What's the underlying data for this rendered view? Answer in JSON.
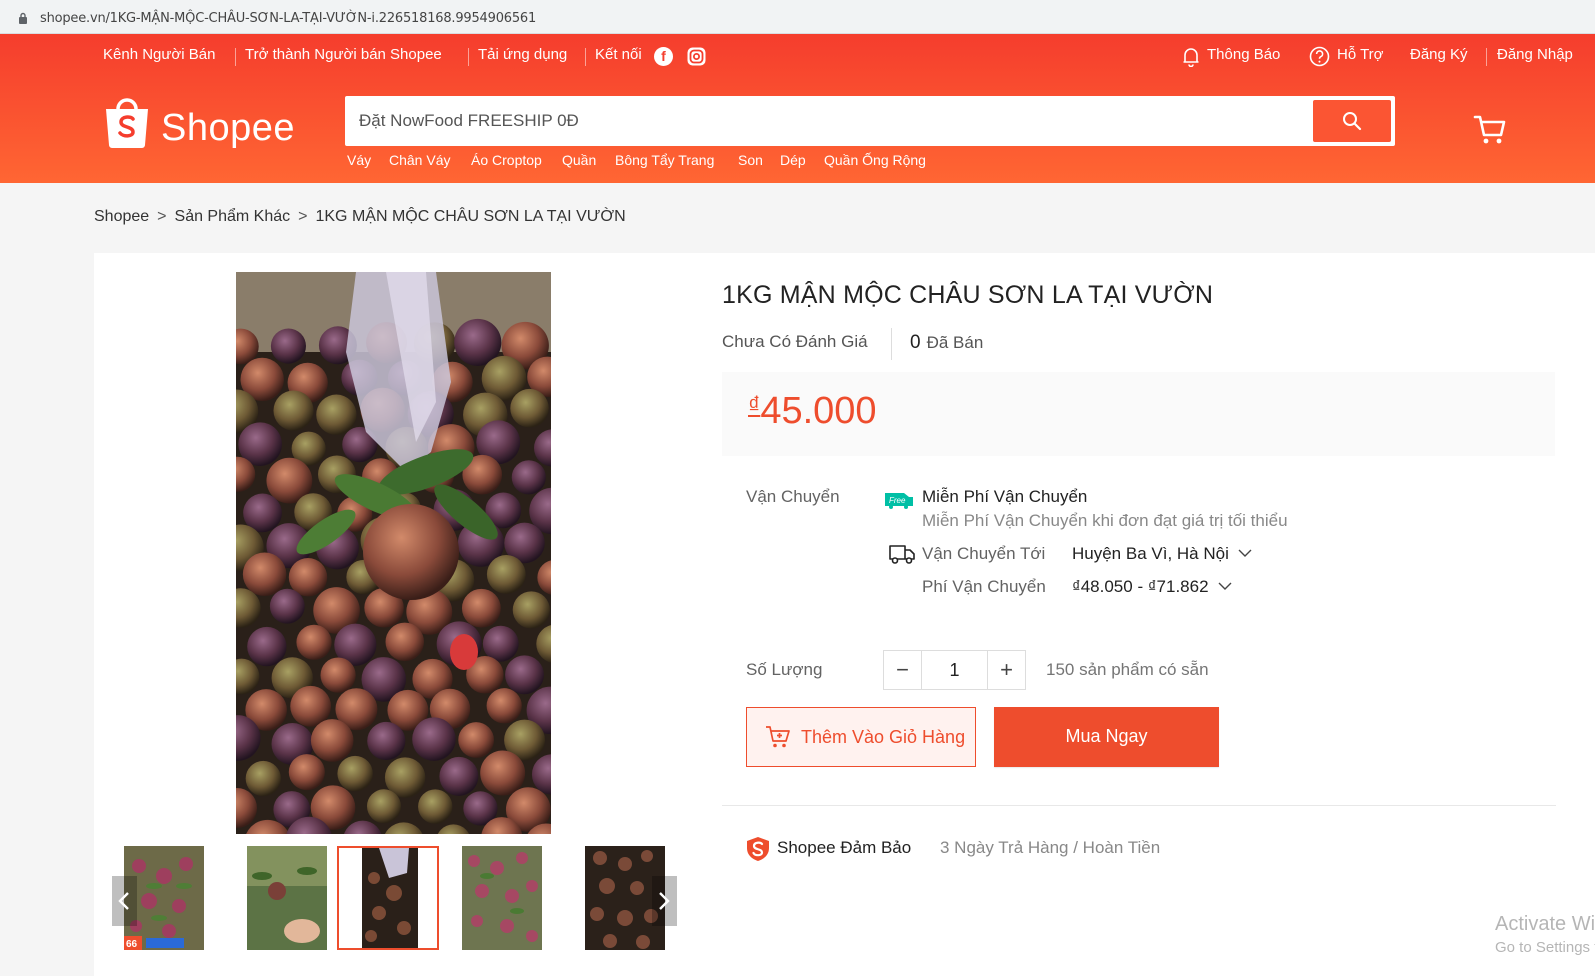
{
  "browser": {
    "url": "shopee.vn/1KG-MẬN-MỘC-CHÂU-SƠN-LA-TẠI-VƯỜN-i.226518168.9954906561"
  },
  "header": {
    "topnav_left": [
      "Kênh Người Bán",
      "Trở thành Người bán Shopee",
      "Tải ứng dụng",
      "Kết nối"
    ],
    "topnav_right": {
      "notifications": "Thông Báo",
      "help": "Hỗ Trợ",
      "register": "Đăng Ký",
      "login": "Đăng Nhập"
    },
    "logo_text": "Shopee",
    "search_placeholder": "Đặt NowFood FREESHIP 0Đ",
    "suggestions": [
      "Váy",
      "Chân Váy",
      "Áo Croptop",
      "Quần",
      "Bông Tẩy Trang",
      "Son",
      "Dép",
      "Quần Ống Rộng"
    ]
  },
  "breadcrumb": [
    "Shopee",
    "Sản Phẩm Khác",
    "1KG MẬN MỘC CHÂU SƠN LA TẠI VƯỜN"
  ],
  "product": {
    "title": "1KG MẬN MỘC CHÂU SƠN LA TẠI VƯỜN",
    "rating_text": "Chưa Có Đánh Giá",
    "sold_count": "0",
    "sold_label": "Đã Bán",
    "currency": "₫",
    "price": "45.000",
    "free_badge": "Free",
    "shipping": {
      "label": "Vận Chuyển",
      "free_title": "Miễn Phí Vận Chuyển",
      "free_desc": "Miễn Phí Vận Chuyển khi đơn đạt giá trị tối thiểu",
      "to_label": "Vận Chuyển Tới",
      "to_value": "Huyện Ba Vì, Hà Nội",
      "fee_label": "Phí Vận Chuyển",
      "fee_value": "₫48.050 - ₫71.862"
    },
    "quantity": {
      "label": "Số Lượng",
      "value": "1",
      "minus": "−",
      "plus": "+",
      "stock": "150 sản phẩm có sẵn"
    },
    "add_to_cart": "Thêm Vào Giỏ Hàng",
    "buy_now": "Mua Ngay",
    "guarantee_title": "Shopee Đảm Bảo",
    "guarantee_desc": "3 Ngày Trả Hàng / Hoàn Tiền",
    "thumb_badge": "66"
  },
  "watermark": {
    "line1": "Activate Wi",
    "line2": "Go to Settings t"
  }
}
